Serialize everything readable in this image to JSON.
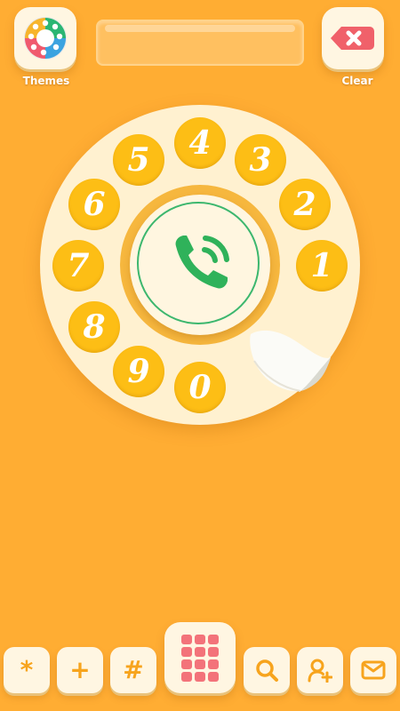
{
  "header": {
    "themes_label": "Themes",
    "clear_label": "Clear"
  },
  "display": {
    "number": ""
  },
  "dial": {
    "digits": [
      "1",
      "2",
      "3",
      "4",
      "5",
      "6",
      "7",
      "8",
      "9",
      "0"
    ]
  },
  "bottom_bar": {
    "star_label": "*",
    "plus_label": "+",
    "hash_label": "#"
  },
  "icons": {
    "themes": "rotary-dial-icon",
    "clear": "backspace-icon",
    "call": "phone-call-icon",
    "keypad": "keypad-grid-icon",
    "search": "search-icon",
    "add_contact": "add-contact-icon",
    "message": "envelope-icon"
  },
  "colors": {
    "background": "#FFAD33",
    "dial_face": "#FFF1D0",
    "digit": "#FDBE15",
    "call_green": "#2FB25A",
    "clear_red": "#F0616A",
    "keypad_pink": "#F3737A"
  }
}
